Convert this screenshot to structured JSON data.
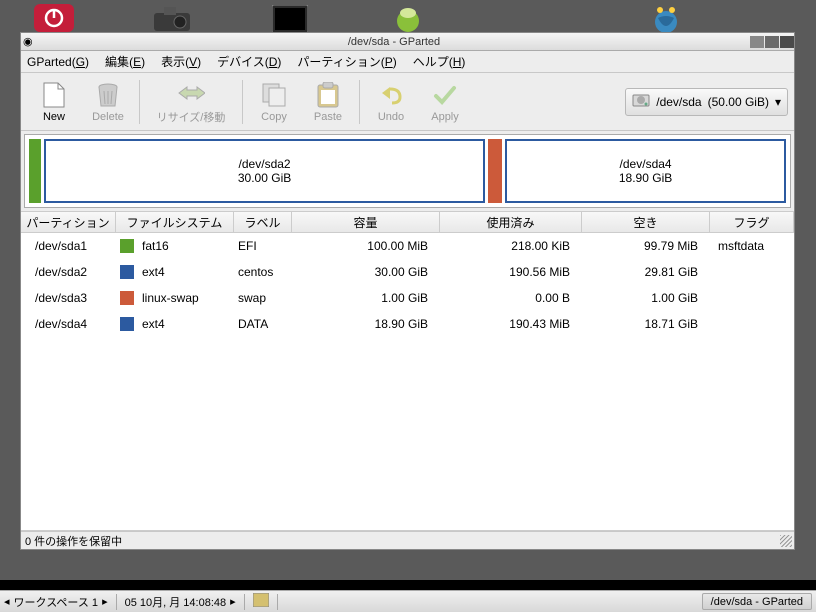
{
  "window": {
    "title": "/dev/sda - GParted"
  },
  "menu": {
    "gparted": "GParted",
    "gparted_u": "G",
    "edit": "編集",
    "edit_u": "E",
    "view": "表示",
    "view_u": "V",
    "device": "デバイス",
    "device_u": "D",
    "partition": "パーティション",
    "partition_u": "P",
    "help": "ヘルプ",
    "help_u": "H"
  },
  "toolbar": {
    "new": "New",
    "delete": "Delete",
    "resize": "リサイズ/移動",
    "copy": "Copy",
    "paste": "Paste",
    "undo": "Undo",
    "apply": "Apply"
  },
  "device_combo": {
    "name": "/dev/sda",
    "size": "(50.00 GiB)"
  },
  "disk_slices": {
    "big_name": "/dev/sda2",
    "big_size": "30.00 GiB",
    "sm_name": "/dev/sda4",
    "sm_size": "18.90 GiB"
  },
  "columns": {
    "partition": "パーティション",
    "filesystem": "ファイルシステム",
    "label": "ラベル",
    "size": "容量",
    "used": "使用済み",
    "free": "空き",
    "flags": "フラグ"
  },
  "rows": [
    {
      "part": "/dev/sda1",
      "fs": "fat16",
      "color": "#5aa02c",
      "label": "EFI",
      "size": "100.00 MiB",
      "used": "218.00 KiB",
      "free": "99.79 MiB",
      "flags": "msftdata"
    },
    {
      "part": "/dev/sda2",
      "fs": "ext4",
      "color": "#2c5aa0",
      "label": "centos",
      "size": "30.00 GiB",
      "used": "190.56 MiB",
      "free": "29.81 GiB",
      "flags": ""
    },
    {
      "part": "/dev/sda3",
      "fs": "linux-swap",
      "color": "#cc5a3a",
      "label": "swap",
      "size": "1.00 GiB",
      "used": "0.00 B",
      "free": "1.00 GiB",
      "flags": ""
    },
    {
      "part": "/dev/sda4",
      "fs": "ext4",
      "color": "#2c5aa0",
      "label": "DATA",
      "size": "18.90 GiB",
      "used": "190.43 MiB",
      "free": "18.71 GiB",
      "flags": ""
    }
  ],
  "status": "0 件の操作を保留中",
  "taskbar": {
    "workspace": "ワークスペース 1",
    "clock": "05 10月, 月 14:08:48",
    "task": "/dev/sda - GParted"
  }
}
